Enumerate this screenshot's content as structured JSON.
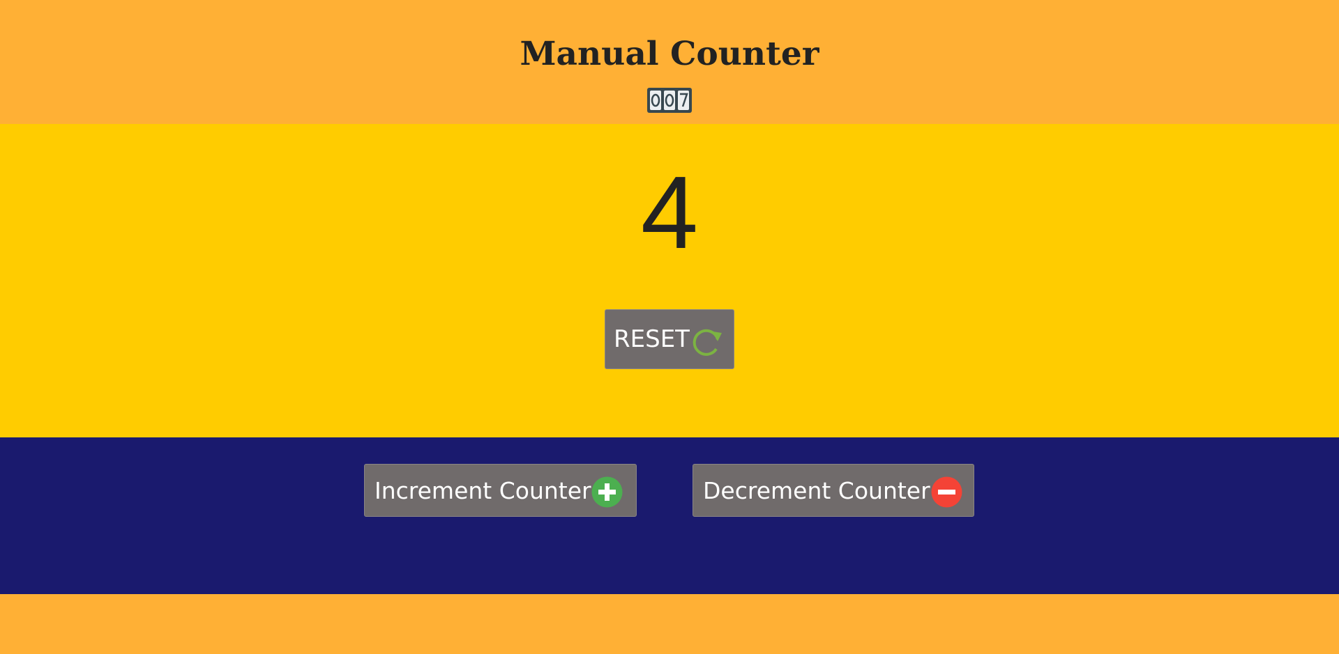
{
  "header": {
    "title": "Manual Counter",
    "icon": "abacus-counter-icon"
  },
  "counter": {
    "value": "4"
  },
  "reset_button": {
    "label": "RESET",
    "icon": "refresh-icon"
  },
  "actions": {
    "increment_label": "Increment Counter",
    "increment_icon": "plus-circle-icon",
    "decrement_label": "Decrement Counter",
    "decrement_icon": "minus-circle-icon"
  },
  "colors": {
    "header_bg": "#FFB035",
    "counter_bg": "#FFCC00",
    "actions_bg": "#1A1A6E",
    "button_bg": "#706B6B",
    "plus_green": "#4CAF50",
    "minus_red": "#F44336",
    "refresh_green": "#7CB342"
  }
}
